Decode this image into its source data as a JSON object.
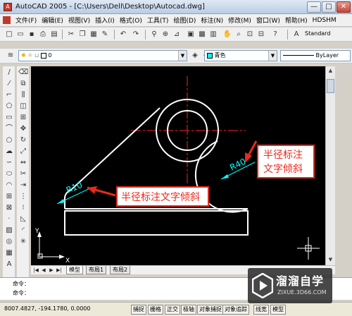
{
  "window": {
    "title": "AutoCAD 2005 - [C:\\Users\\Dell\\Desktop\\Autocad.dwg]",
    "controls": {
      "minimize": "—",
      "maximize": "□",
      "close": "✕"
    }
  },
  "menubar": {
    "items": [
      "文件(F)",
      "编辑(E)",
      "视图(V)",
      "插入(I)",
      "格式(O)",
      "工具(T)",
      "绘图(D)",
      "标注(N)",
      "修改(M)",
      "窗口(W)",
      "帮助(H)",
      "HDSHM"
    ]
  },
  "toolbars": {
    "text_style": "Standard",
    "layer_value": "0",
    "color_value": "青色",
    "linetype_value": "ByLayer"
  },
  "drawing": {
    "annotation_left": "R10",
    "annotation_right": "R40",
    "callout_left": "半径标注文字倾斜",
    "callout_right_line1": "半径标注",
    "callout_right_line2": "文字倾斜",
    "ucs_x_label": "X",
    "ucs_y_label": "Y",
    "colors": {
      "geometry": "#ffffff",
      "dimension": "#00ffff",
      "centerline": "#ff2020",
      "callout": "#e8291c"
    }
  },
  "tabs": {
    "model": "模型",
    "layout1": "布局1",
    "layout2": "布局2"
  },
  "command": {
    "line1": "命令：",
    "line2": "命令："
  },
  "status": {
    "coordinates": "8007.4827, -194.1780, 0.0000",
    "buttons": [
      "捕捉",
      "栅格",
      "正交",
      "极轴",
      "对象捕捉",
      "对象追踪",
      "线宽",
      "模型"
    ]
  },
  "watermark": {
    "name": "溜溜自学",
    "url": "ZIXUE.3D66.COM"
  }
}
